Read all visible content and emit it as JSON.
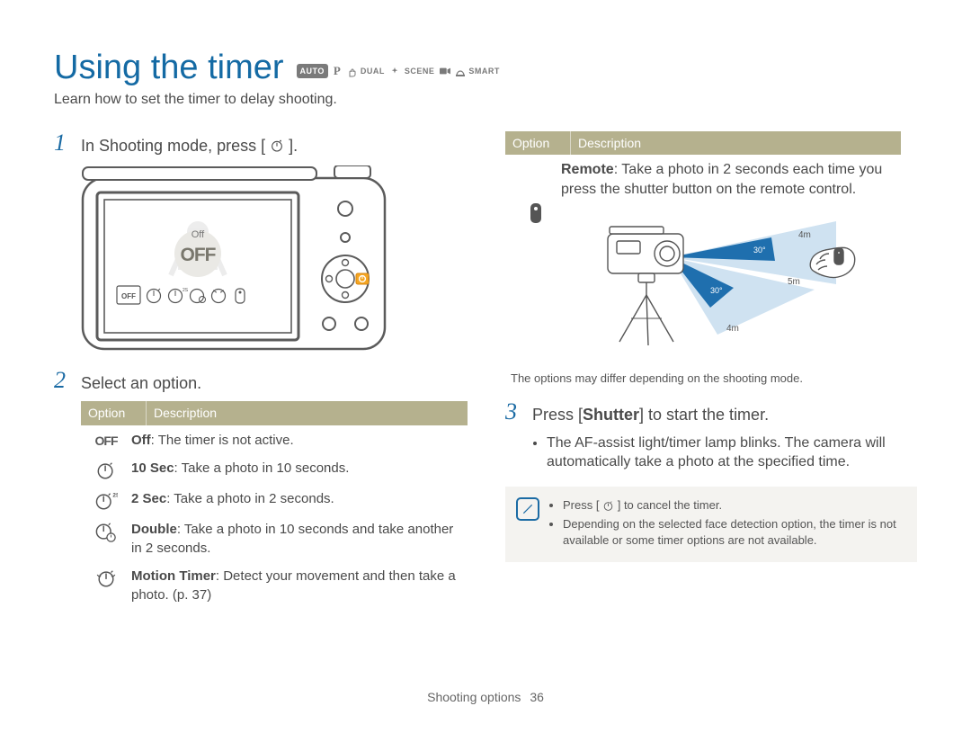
{
  "title": "Using the timer",
  "mode_badges": {
    "auto": "AUTO",
    "p": "P",
    "dual": "DUAL",
    "scene": "SCENE",
    "smart": "SMART"
  },
  "subtitle": "Learn how to set the timer to delay shooting.",
  "steps": {
    "s1_num": "1",
    "s1_text_a": "In Shooting mode, press [",
    "s1_text_b": "].",
    "s2_num": "2",
    "s2_text": "Select an option.",
    "s3_num": "3",
    "s3_text_a": "Press [",
    "s3_text_bold": "Shutter",
    "s3_text_b": "] to start the timer.",
    "s3_bullet": "The AF-assist light/timer lamp blinks. The camera will automatically take a photo at the specified time."
  },
  "camera_screen": {
    "label": "Off",
    "big": "OFF"
  },
  "table_header": {
    "option": "Option",
    "description": "Description"
  },
  "options_left": [
    {
      "icon": "off",
      "bold": "Off",
      "rest": ": The timer is not active."
    },
    {
      "icon": "t10",
      "bold": "10 Sec",
      "rest": ": Take a photo in 10 seconds."
    },
    {
      "icon": "t2",
      "bold": "2 Sec",
      "rest": ": Take a photo in 2 seconds."
    },
    {
      "icon": "double",
      "bold": "Double",
      "rest": ": Take a photo in 10 seconds and take another in 2 seconds."
    },
    {
      "icon": "motion",
      "bold": "Motion Timer",
      "rest": ": Detect your movement and then take a photo. (p. 37)"
    }
  ],
  "remote": {
    "bold": "Remote",
    "rest": ": Take a photo in 2 seconds each time you press the shutter button on the remote control.",
    "dist_a": "4m",
    "dist_b": "5m",
    "dist_c": "4m",
    "angle_a": "30°",
    "angle_b": "30°"
  },
  "footnote_right": "The options may differ depending on the shooting mode.",
  "note": {
    "line1_a": "Press [",
    "line1_b": "] to cancel the timer.",
    "line2": "Depending on the selected face detection option, the timer is not available or some timer options are not available."
  },
  "footer": {
    "section": "Shooting options",
    "page": "36"
  }
}
